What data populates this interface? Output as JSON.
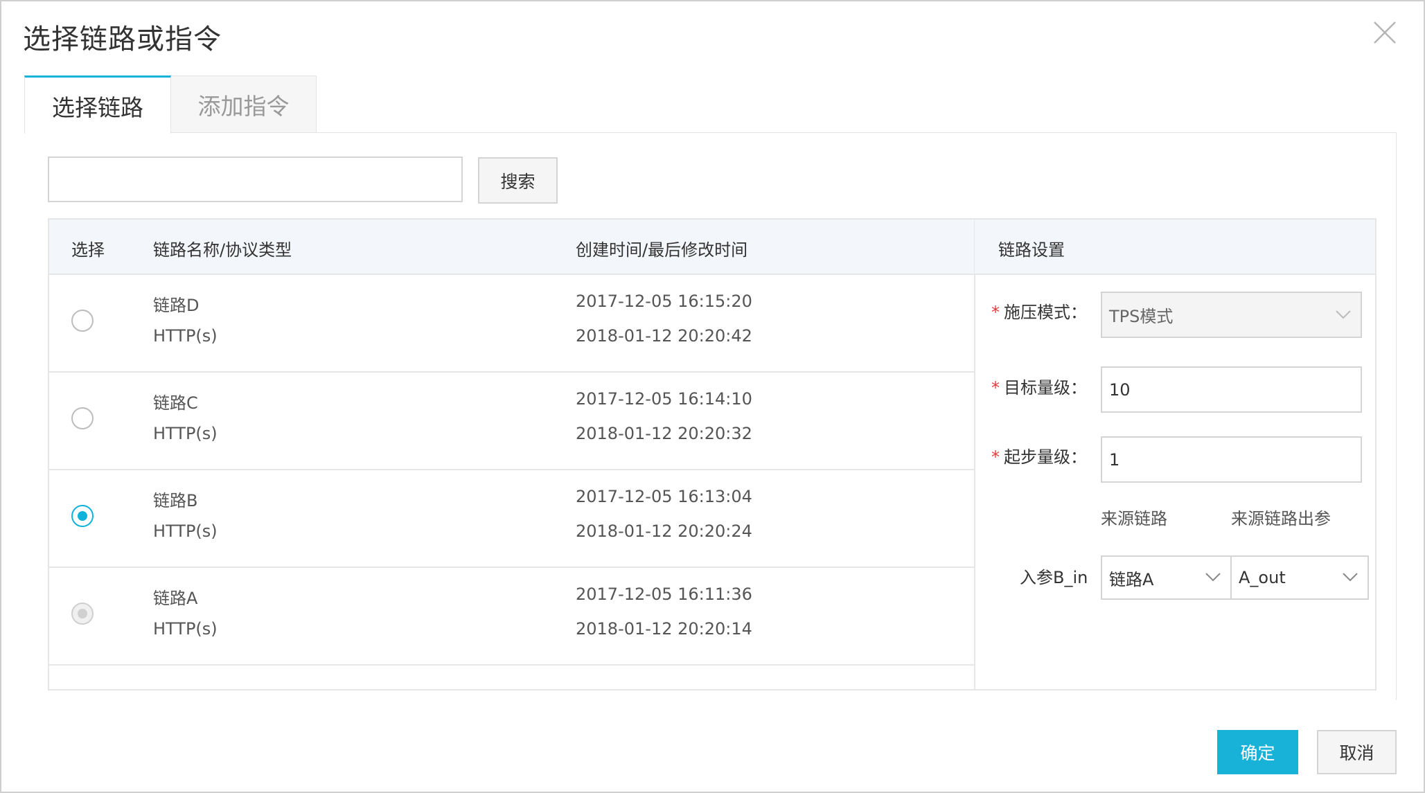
{
  "dialog": {
    "title": "选择链路或指令"
  },
  "tabs": [
    {
      "label": "选择链路",
      "active": true
    },
    {
      "label": "添加指令",
      "active": false
    }
  ],
  "search": {
    "value": "",
    "button_label": "搜索"
  },
  "table": {
    "headers": {
      "select": "选择",
      "name": "链路名称/协议类型",
      "time": "创建时间/最后修改时间"
    },
    "rows": [
      {
        "name": "链路D",
        "protocol": "HTTP(s)",
        "created": "2017-12-05 16:15:20",
        "modified": "2018-01-12 20:20:42",
        "state": "unchecked"
      },
      {
        "name": "链路C",
        "protocol": "HTTP(s)",
        "created": "2017-12-05 16:14:10",
        "modified": "2018-01-12 20:20:32",
        "state": "unchecked"
      },
      {
        "name": "链路B",
        "protocol": "HTTP(s)",
        "created": "2017-12-05 16:13:04",
        "modified": "2018-01-12 20:20:24",
        "state": "checked"
      },
      {
        "name": "链路A",
        "protocol": "HTTP(s)",
        "created": "2017-12-05 16:11:36",
        "modified": "2018-01-12 20:20:14",
        "state": "disabled"
      }
    ]
  },
  "settings": {
    "header": "链路设置",
    "pressure_mode": {
      "label": "施压模式：",
      "value": "TPS模式"
    },
    "target_level": {
      "label": "目标量级：",
      "value": "10"
    },
    "start_level": {
      "label": "起步量级：",
      "value": "1"
    },
    "source_link_header": "来源链路",
    "source_param_header": "来源链路出参",
    "param_label": "入参B_in",
    "param_source_link": "链路A",
    "param_source_output": "A_out"
  },
  "footer": {
    "confirm_label": "确定",
    "cancel_label": "取消"
  },
  "colors": {
    "accent": "#18b2d8",
    "required": "#e4393c"
  }
}
